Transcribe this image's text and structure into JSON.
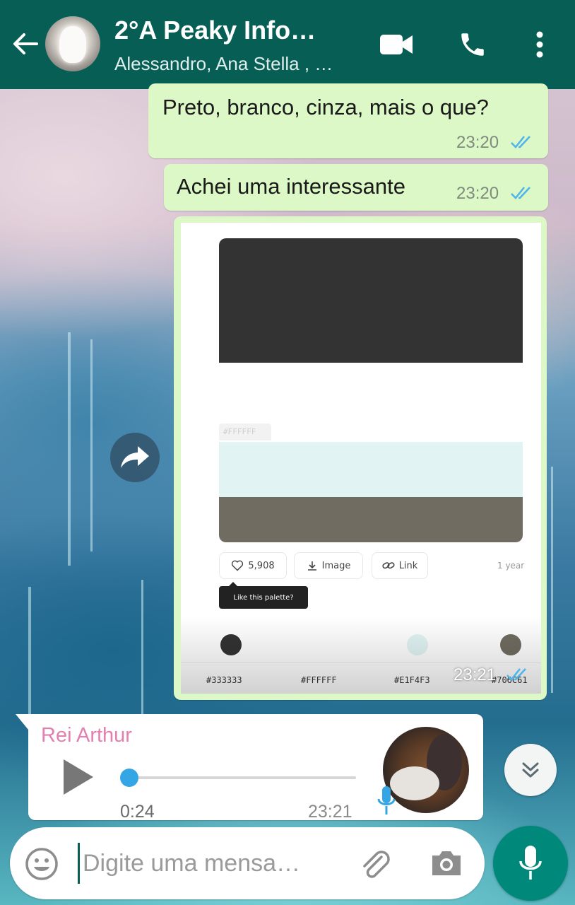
{
  "header": {
    "title": "2°A Peaky Info…",
    "subtitle": "Alessandro, Ana Stella , …",
    "icons": [
      "back-arrow-icon",
      "group-avatar",
      "video-call-icon",
      "phone-icon",
      "more-options-icon"
    ]
  },
  "messages": [
    {
      "text": "Preto, branco, cinza, mais o que?",
      "time": "23:20",
      "status": "read"
    },
    {
      "text": "Achei uma interessante",
      "time": "23:20",
      "status": "read"
    }
  ],
  "image_message": {
    "time": "23:21",
    "status": "read",
    "palette": {
      "swatch_label": "#FFFFFF",
      "likes": "5,908",
      "image_label": "Image",
      "link_label": "Link",
      "age": "1 year",
      "tooltip": "Like this palette?",
      "colors": [
        {
          "hex": "#333333",
          "color": "#333333"
        },
        {
          "hex": "#FFFFFF",
          "color": "#FFFFFF"
        },
        {
          "hex": "#E1F4F3",
          "color": "#E1F4F3"
        },
        {
          "hex": "#706C61",
          "color": "#706C61"
        }
      ]
    }
  },
  "voice_message": {
    "sender": "Rei Arthur",
    "duration": "0:24",
    "time": "23:21",
    "progress": 0.0
  },
  "input": {
    "placeholder": "Digite uma mensa…"
  },
  "colors": {
    "header_bg": "#075E54",
    "outgoing_bubble": "#DCF8C6",
    "read_ticks": "#4FB6EC",
    "sender_name": "#E57FB0",
    "mic_button": "#00897B"
  }
}
